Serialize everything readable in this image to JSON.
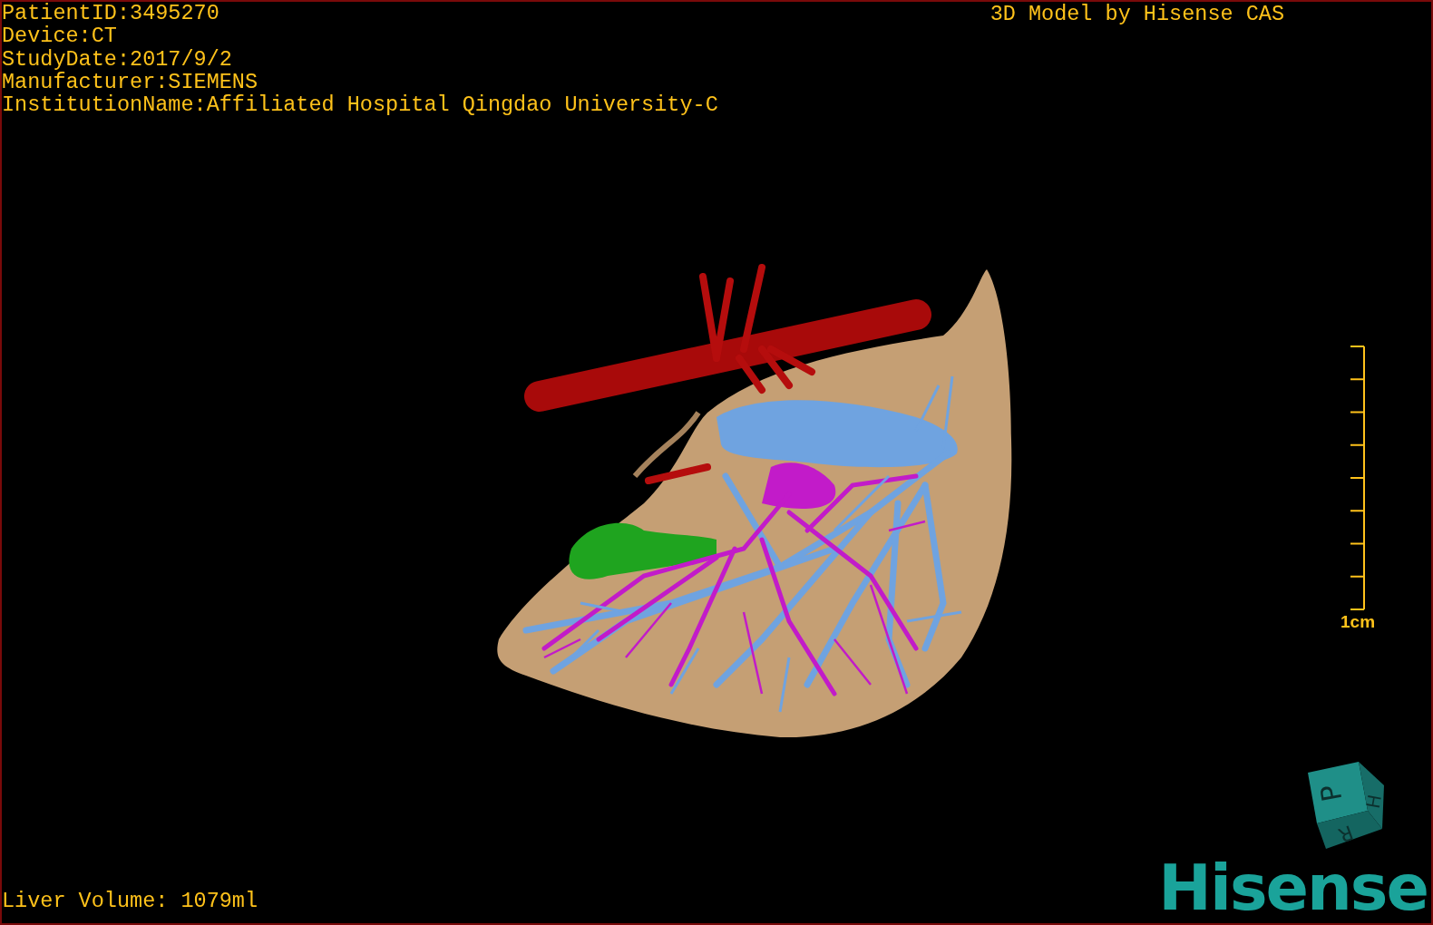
{
  "patient_info": [
    "PatientID:3495270",
    "Device:CT",
    "StudyDate:2017/9/2",
    "Manufacturer:SIEMENS",
    "InstitutionName:Affiliated Hospital Qingdao University-C"
  ],
  "model_title": "3D Model by Hisense CAS",
  "scale_bar": {
    "label": "1cm"
  },
  "orientation_cube": {
    "faces": [
      "P",
      "H",
      "R"
    ]
  },
  "liver_volume": "Liver Volume: 1079ml",
  "logo": "Hisense"
}
